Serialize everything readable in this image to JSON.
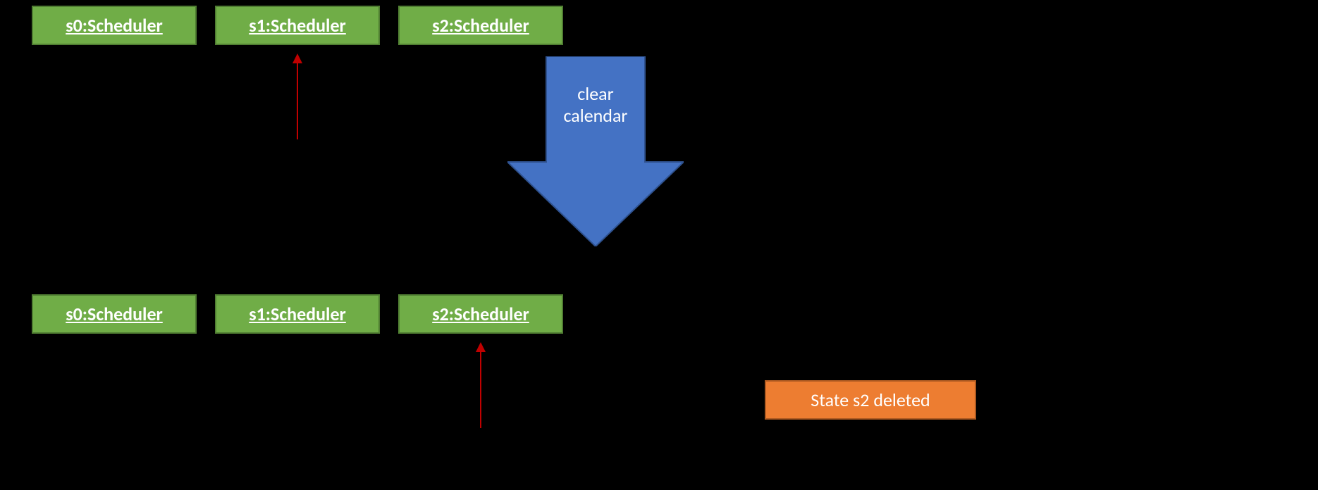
{
  "blocks": {
    "top": [
      "s0:Scheduler",
      "s1:Scheduler",
      "s2:Scheduler"
    ],
    "bottom": [
      "s0:Scheduler",
      "s1:Scheduler",
      "s2:Scheduler"
    ]
  },
  "pointers": {
    "top_active_index": 1,
    "bottom_active_index": 2
  },
  "transition": {
    "line1": "clear",
    "line2": "calendar"
  },
  "status": "State s2 deleted",
  "colors": {
    "object_fill": "#70AD47",
    "object_border": "#507E32",
    "arrow_fill": "#4472C4",
    "arrow_border": "#2F528F",
    "pointer": "#C00000",
    "status_fill": "#ED7D31",
    "status_border": "#AE5A21",
    "background": "#000000",
    "text_on_shape": "#FFFFFF"
  }
}
